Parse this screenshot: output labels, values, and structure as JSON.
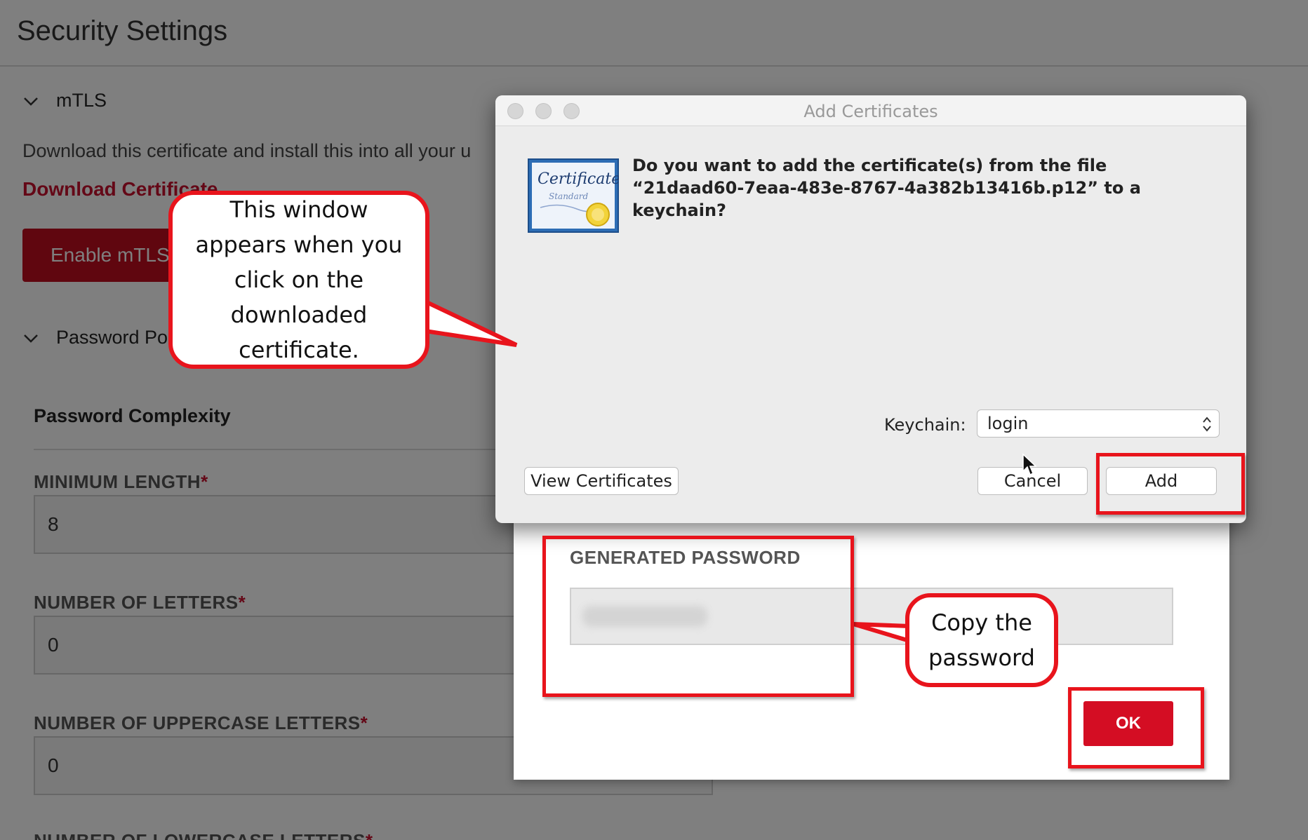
{
  "page": {
    "title": "Security Settings",
    "mtls": {
      "label": "mTLS",
      "description": "Download this certificate and install this into all your u",
      "download_link": "Download Certificate",
      "enable_button": "Enable mTLS"
    },
    "password_policy": {
      "label": "Password Po",
      "subheading": "Password Complexity",
      "fields": [
        {
          "label": "MINIMUM LENGTH",
          "value": "8"
        },
        {
          "label": "NUMBER OF LETTERS",
          "value": "0"
        },
        {
          "label": "NUMBER OF UPPERCASE LETTERS",
          "value": "0"
        },
        {
          "label": "NUMBER OF LOWERCASE LETTERS",
          "value": ""
        }
      ],
      "required_mark": "*"
    }
  },
  "password_modal": {
    "generated_label": "GENERATED PASSWORD",
    "ok_button": "OK"
  },
  "mac_dialog": {
    "title": "Add Certificates",
    "question": "Do you want to add the certificate(s) from the file “21daad60-7eaa-483e-8767-4a382b13416b.p12” to a keychain?",
    "keychain_label": "Keychain:",
    "keychain_value": "login",
    "view_button": "View Certificates",
    "cancel_button": "Cancel",
    "add_button": "Add",
    "icon": "certificate-icon",
    "icon_text_1": "Certificate",
    "icon_text_2": "Standard"
  },
  "annotations": {
    "window_callout": "This window appears when you click on the downloaded certificate.",
    "copy_callout": "Copy the password"
  },
  "colors": {
    "accent_red": "#c8102e",
    "annotation_red": "#e8141c",
    "ok_red": "#d40d23"
  }
}
